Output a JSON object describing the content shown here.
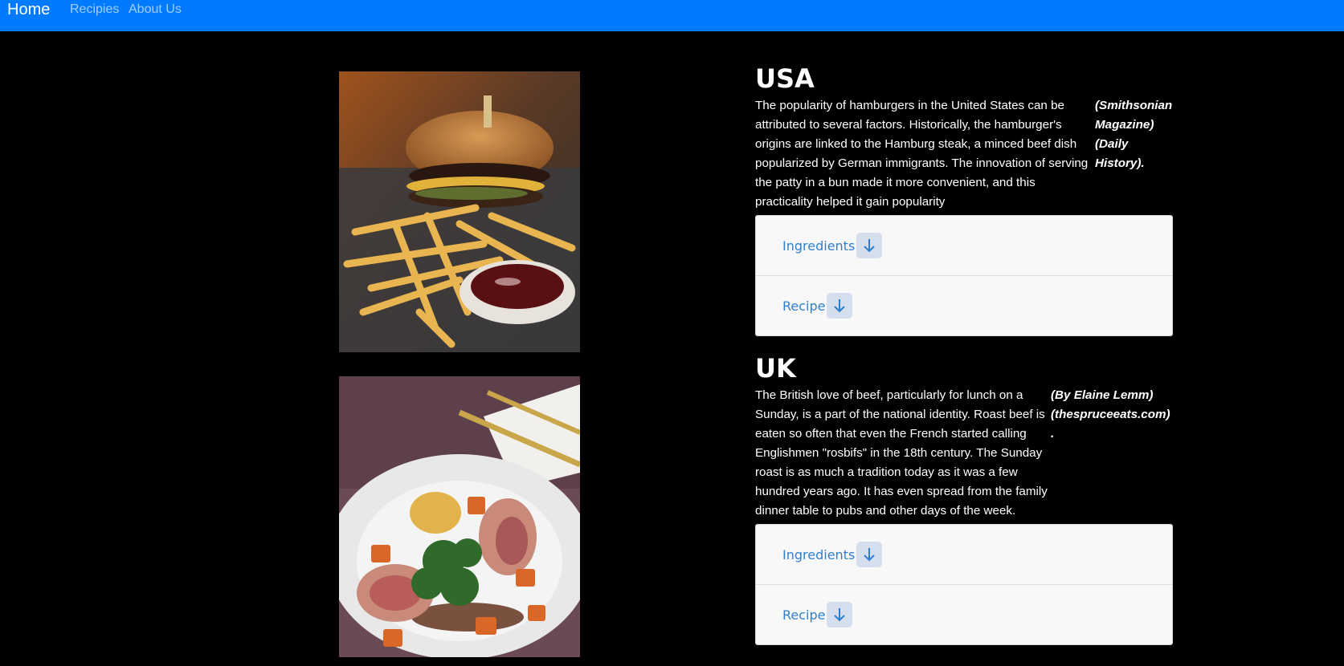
{
  "nav": {
    "brand": "Home",
    "links": [
      "Recipies",
      "About Us"
    ]
  },
  "colors": {
    "navbar": "#007bff",
    "accent": "#2f7fd0",
    "background": "#000000"
  },
  "sections": [
    {
      "country": "USA",
      "image": "burger-and-fries-photo",
      "description": "The popularity of hamburgers in the United States can be attributed to several factors. Historically, the hamburger's origins are linked to the Hamburg steak, a minced beef dish popularized by German immigrants. The innovation of serving the patty in a bun made it more convenient, and this practicality helped it gain popularity",
      "citations": "(Smithsonian Magazine) (Daily History).",
      "accordion": {
        "ingredients": "Ingredients",
        "recipe": "Recipe",
        "icon": "arrow-down-icon"
      }
    },
    {
      "country": "UK",
      "image": "roast-dinner-plate-photo",
      "description": "The British love of beef, particularly for lunch on a Sunday, is a part of the national identity. Roast beef is eaten so often that even the French started calling Englishmen \"rosbifs\" in the 18th century. The Sunday roast is as much a tradition today as it was a few hundred years ago. It has even spread from the family dinner table to pubs and other days of the week.",
      "citations": "(By Elaine Lemm) (thespruceeats.com) .",
      "accordion": {
        "ingredients": "Ingredients",
        "recipe": "Recipe",
        "icon": "arrow-down-icon"
      }
    }
  ]
}
